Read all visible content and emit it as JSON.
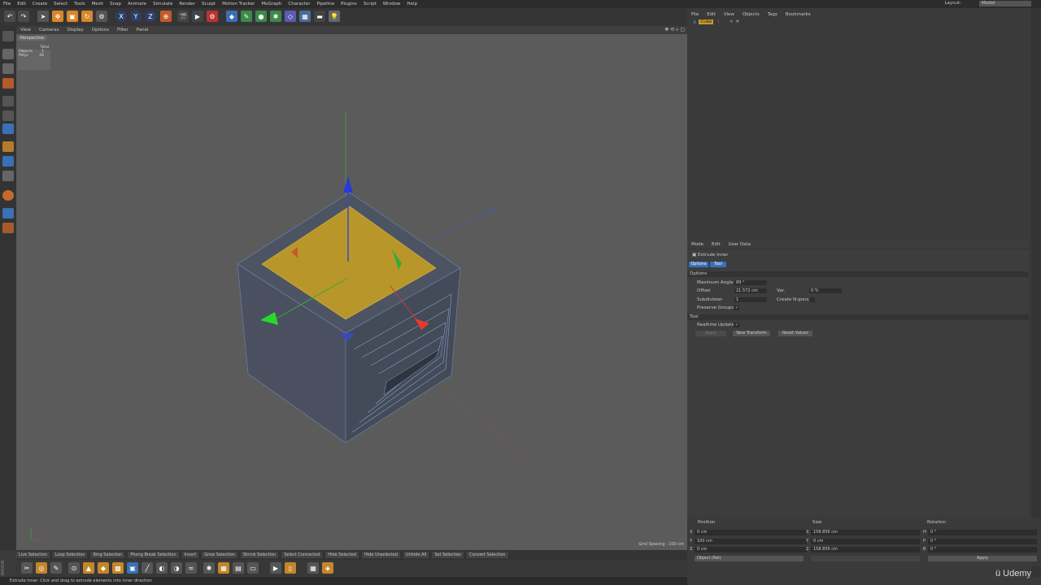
{
  "menubar": {
    "items": [
      "File",
      "Edit",
      "Create",
      "Select",
      "Tools",
      "Mesh",
      "Snap",
      "Animate",
      "Simulate",
      "Render",
      "Sculpt",
      "Motion Tracker",
      "MoGraph",
      "Character",
      "Pipeline",
      "Plugins",
      "Script",
      "Window",
      "Help"
    ],
    "layout_label": "Layout:",
    "layout_value": "Model"
  },
  "toolbar": {
    "axis_x": "X",
    "axis_y": "Y",
    "axis_z": "Z"
  },
  "viewport": {
    "menu": [
      "View",
      "Cameras",
      "Display",
      "Options",
      "Filter",
      "Panel"
    ],
    "camera_label": "Perspective",
    "stats": {
      "header": "Total",
      "objects_label": "Objects",
      "objects_value": "1",
      "polys_label": "Polys",
      "polys_value": "26"
    },
    "grid_spacing": "Grid Spacing : 100 cm"
  },
  "object_manager": {
    "menu": [
      "File",
      "Edit",
      "View",
      "Objects",
      "Tags",
      "Bookmarks"
    ],
    "object_name": "Cube"
  },
  "attribute_manager": {
    "menu": [
      "Mode",
      "Edit",
      "User Data"
    ],
    "tool_name": "Extrude Inner",
    "tabs": [
      "Options",
      "Tool"
    ],
    "section_options": "Options",
    "max_angle_label": "Maximum Angle",
    "max_angle_value": "89 °",
    "offset_label": "Offset",
    "offset_value": "21.572 cm",
    "var_label": "Var.",
    "var_value": "0 %",
    "subdivision_label": "Subdivision",
    "subdivision_value": "1",
    "create_ngons_label": "Create N-gons",
    "preserve_groups_label": "Preserve Groups",
    "preserve_groups_check": "✓",
    "section_tool": "Tool",
    "realtime_update_label": "Realtime Update",
    "realtime_update_check": "✓",
    "apply_label": "Apply",
    "new_transform_label": "New Transform",
    "reset_values_label": "Reset Values"
  },
  "coordinates": {
    "position_head": "Position",
    "size_head": "Size",
    "rotation_head": "Rotation",
    "pos": [
      {
        "axis": "X",
        "value": "0 cm"
      },
      {
        "axis": "Y",
        "value": "100 cm"
      },
      {
        "axis": "Z",
        "value": "0 cm"
      }
    ],
    "size": [
      {
        "axis": "X",
        "value": "158.856 cm"
      },
      {
        "axis": "Y",
        "value": "0 cm"
      },
      {
        "axis": "Z",
        "value": "158.856 cm"
      }
    ],
    "rot": [
      {
        "axis": "H",
        "value": "0 °"
      },
      {
        "axis": "P",
        "value": "0 °"
      },
      {
        "axis": "B",
        "value": "0 °"
      }
    ],
    "mode_select": "Object (Rel)",
    "apply_label": "Apply"
  },
  "selection_bar": [
    "Live Selection",
    "Loop Selection",
    "Ring Selection",
    "Phong Break Selection",
    "Invert",
    "Grow Selection",
    "Shrink Selection",
    "Select Connected",
    "Hide Selected",
    "Hide Unselected",
    "Unhide All",
    "Set Selection",
    "Convert Selection"
  ],
  "status": "Extrude Inner: Click and drag to extrude elements into inner direction",
  "watermark": "Udemy",
  "colors": {
    "accent": "#3b6fb6",
    "viewport_bg": "#5b5b5b",
    "selection": "#b8962a"
  }
}
